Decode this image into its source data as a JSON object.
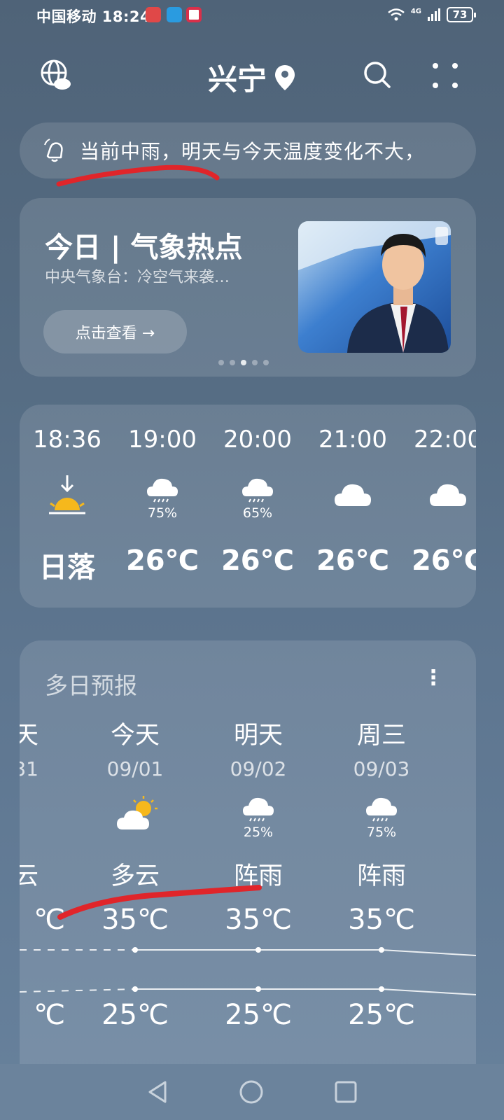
{
  "status_bar": {
    "carrier_time": "中国移动 18:24",
    "network": "4G",
    "battery": "73"
  },
  "header": {
    "city": "兴宁"
  },
  "alert": {
    "text": "当前中雨，明天与今天温度变化不大，"
  },
  "hot_topic": {
    "title": "今日 | 气象热点",
    "subtitle": "中央气象台：冷空气来袭…",
    "button_label": "点击查看 →"
  },
  "hourly": [
    {
      "time": "18:36",
      "icon": "sunset-icon",
      "pop": "",
      "temp": "日落"
    },
    {
      "time": "19:00",
      "icon": "rain-cloud-icon",
      "pop": "75%",
      "temp": "26℃"
    },
    {
      "time": "20:00",
      "icon": "rain-cloud-icon",
      "pop": "65%",
      "temp": "26℃"
    },
    {
      "time": "21:00",
      "icon": "cloud-icon",
      "pop": "",
      "temp": "26℃"
    },
    {
      "time": "22:00",
      "icon": "cloud-icon",
      "pop": "",
      "temp": "26℃"
    }
  ],
  "multi_day": {
    "title": "多日预报",
    "days": [
      {
        "name": "天",
        "date": "31",
        "icon": "partly-cloudy-icon",
        "pop": "",
        "condition": "云",
        "high": "℃",
        "low": "℃"
      },
      {
        "name": "今天",
        "date": "09/01",
        "icon": "partly-cloudy-icon",
        "pop": "",
        "condition": "多云",
        "high": "35℃",
        "low": "25℃"
      },
      {
        "name": "明天",
        "date": "09/02",
        "icon": "rain-cloud-icon",
        "pop": "25%",
        "condition": "阵雨",
        "high": "35℃",
        "low": "25℃"
      },
      {
        "name": "周三",
        "date": "09/03",
        "icon": "rain-cloud-icon",
        "pop": "75%",
        "condition": "阵雨",
        "high": "35℃",
        "low": "25℃"
      }
    ]
  },
  "colors": {
    "annotation_red": "#e0252a",
    "sun_yellow": "#f6b81c"
  }
}
